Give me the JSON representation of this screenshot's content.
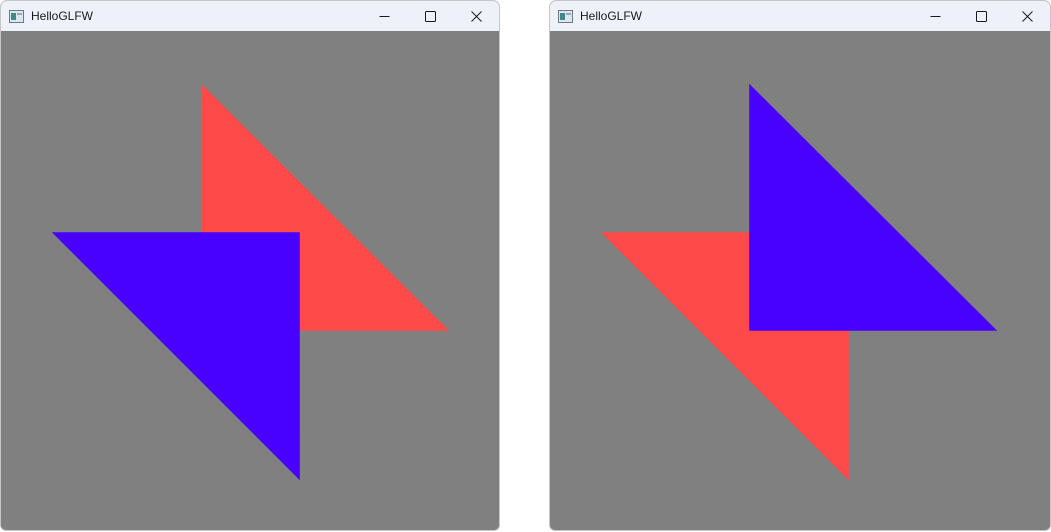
{
  "windows": [
    {
      "title": "HelloGLFW",
      "controls": {
        "minimize": "minimize",
        "maximize": "maximize",
        "close": "close"
      },
      "scene": {
        "background": "#808080",
        "front_triangle": "blue",
        "back_triangle": "red"
      }
    },
    {
      "title": "HelloGLFW",
      "controls": {
        "minimize": "minimize",
        "maximize": "maximize",
        "close": "close"
      },
      "scene": {
        "background": "#808080",
        "front_triangle": "blue",
        "back_triangle": "red"
      }
    }
  ],
  "colors": {
    "red_triangle": "#ff4a4a",
    "blue_triangle": "#4800ff",
    "clear": "#808080",
    "titlebar": "#eef2f8"
  },
  "icons": {
    "app": "app-window-icon",
    "minimize": "minimize-icon",
    "maximize": "maximize-icon",
    "close": "close-icon"
  }
}
